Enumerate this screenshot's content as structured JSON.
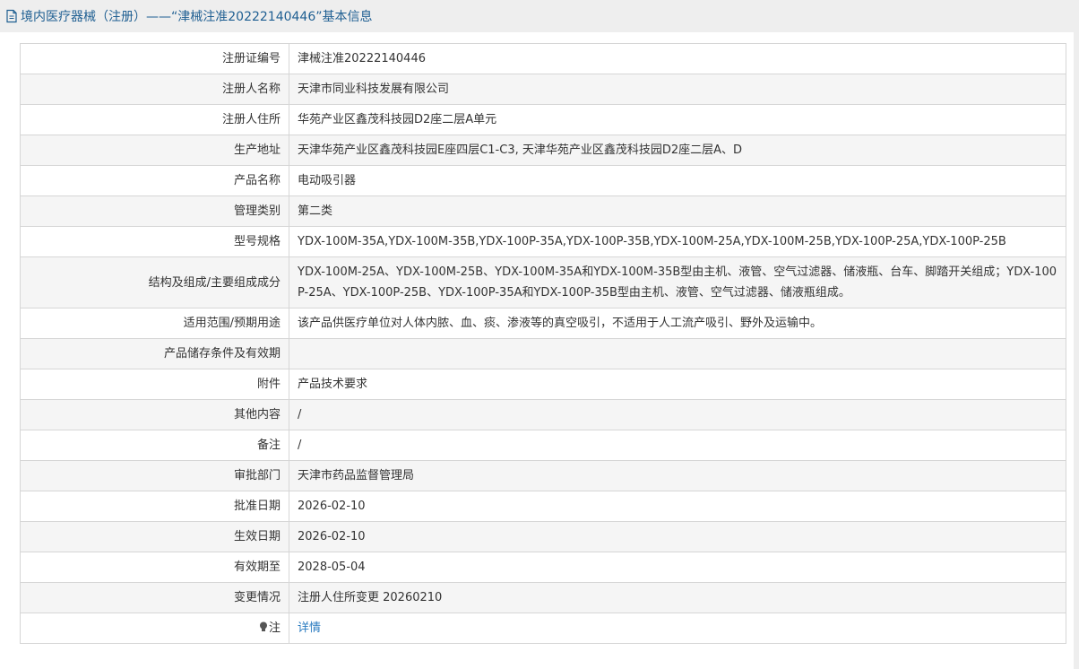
{
  "header": {
    "title": "境内医疗器械（注册）——“津械注准20222140446”基本信息",
    "color": "#1f5f92"
  },
  "rows": [
    {
      "label": "注册证编号",
      "value": "津械注准20222140446"
    },
    {
      "label": "注册人名称",
      "value": "天津市同业科技发展有限公司"
    },
    {
      "label": "注册人住所",
      "value": "华苑产业区鑫茂科技园D2座二层A单元"
    },
    {
      "label": "生产地址",
      "value": "天津华苑产业区鑫茂科技园E座四层C1-C3, 天津华苑产业区鑫茂科技园D2座二层A、D"
    },
    {
      "label": "产品名称",
      "value": "电动吸引器"
    },
    {
      "label": "管理类别",
      "value": "第二类"
    },
    {
      "label": "型号规格",
      "value": "YDX-100M-35A,YDX-100M-35B,YDX-100P-35A,YDX-100P-35B,YDX-100M-25A,YDX-100M-25B,YDX-100P-25A,YDX-100P-25B"
    },
    {
      "label": "结构及组成/主要组成成分",
      "value": "YDX-100M-25A、YDX-100M-25B、YDX-100M-35A和YDX-100M-35B型由主机、液管、空气过滤器、储液瓶、台车、脚踏开关组成；YDX-100P-25A、YDX-100P-25B、YDX-100P-35A和YDX-100P-35B型由主机、液管、空气过滤器、储液瓶组成。"
    },
    {
      "label": "适用范围/预期用途",
      "value": "该产品供医疗单位对人体内脓、血、痰、渗液等的真空吸引，不适用于人工流产吸引、野外及运输中。"
    },
    {
      "label": "产品储存条件及有效期",
      "value": ""
    },
    {
      "label": "附件",
      "value": "产品技术要求"
    },
    {
      "label": "其他内容",
      "value": "/"
    },
    {
      "label": "备注",
      "value": "/"
    },
    {
      "label": "审批部门",
      "value": "天津市药品监督管理局"
    },
    {
      "label": "批准日期",
      "value": "2026-02-10"
    },
    {
      "label": "生效日期",
      "value": "2026-02-10"
    },
    {
      "label": "有效期至",
      "value": "2028-05-04"
    },
    {
      "label": "变更情况",
      "value": "注册人住所变更 20260210"
    }
  ],
  "note_row": {
    "label": "注",
    "link_text": "详情",
    "icon": "lightbulb-icon",
    "link_color": "#2a7bc0"
  },
  "colors": {
    "row_alt": "#f5f5f5",
    "border": "#d6d6d6",
    "header_bg": "#eeeeee"
  }
}
